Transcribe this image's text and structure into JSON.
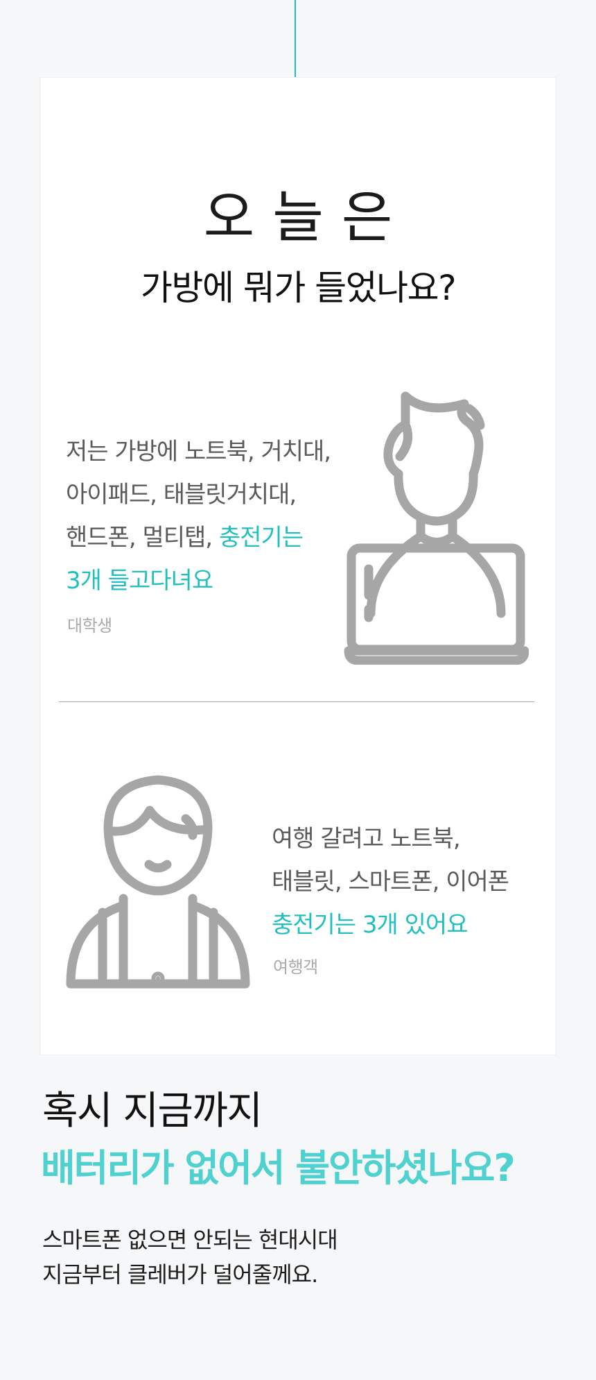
{
  "header": {
    "title_top": "오늘은",
    "title_main": "가방에 뭐가 들었나요?"
  },
  "testimonials": [
    {
      "lines": [
        "저는 가방에 노트북, 거치대,",
        "아이패드, 태블릿거치대,"
      ],
      "line3_plain": "핸드폰, 멀티탭, ",
      "line3_highlight": "충전기는",
      "line4_highlight": "3개 들고다녀요",
      "author": "대학생",
      "icon": "laptop-user-icon"
    },
    {
      "lines": [
        "여행 갈려고 노트북,",
        "태블릿, 스마트폰, 이어폰"
      ],
      "highlight": "충전기는 3개 있어요",
      "author": "여행객",
      "icon": "backpacker-icon"
    }
  ],
  "bottom": {
    "line1": "혹시 지금까지",
    "line2": "배터리가 없어서 불안하셨나요?",
    "desc_line1": "스마트폰 없으면 안되는 현대시대",
    "desc_line2": "지금부터 클레버가 덜어줄께요."
  },
  "colors": {
    "accent": "#23bdbd",
    "accent_light": "#4ed1cf",
    "icon_gray": "#a6a6a6",
    "text_gray": "#5a5a5a"
  }
}
